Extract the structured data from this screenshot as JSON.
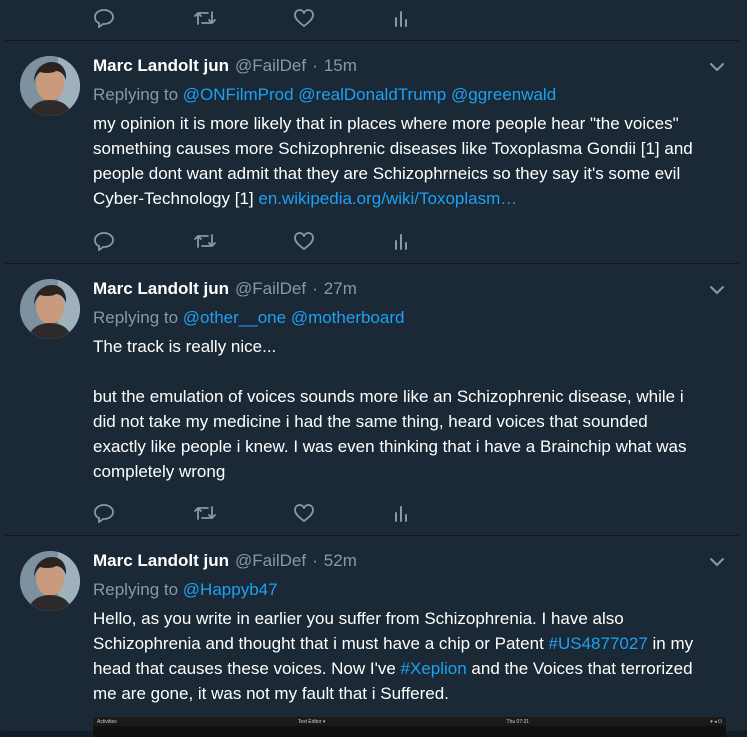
{
  "icons": {
    "reply": "reply-icon",
    "retweet": "retweet-icon",
    "like": "heart-icon",
    "analytics": "analytics-icon",
    "menu": "chevron-down-icon"
  },
  "colors": {
    "background": "#1b2836",
    "link": "#1da1f2",
    "muted": "#8899a6",
    "text": "#ffffff",
    "divider": "#10171e"
  },
  "tweets": [
    {
      "name": "Marc Landolt jun",
      "handle": "@FailDef",
      "separator": "·",
      "time": "15m",
      "replying_prefix": "Replying to",
      "replying_to": [
        "@ONFilmProd",
        "@realDonaldTrump",
        "@ggreenwald"
      ],
      "lines": [
        "my opinion it is more likely that in places where more people hear \"the voices\"",
        "something causes more Schizophrenic diseases like Toxoplasma Gondii [1] and",
        "people dont want admit that they are Schizophrneics so they say it's some evil",
        "Cyber-Technology [1] "
      ],
      "link": "en.wikipedia.org/wiki/Toxoplasm…"
    },
    {
      "name": "Marc Landolt jun",
      "handle": "@FailDef",
      "separator": "·",
      "time": "27m",
      "replying_prefix": "Replying to",
      "replying_to": [
        "@other__one",
        "@motherboard"
      ],
      "lines": [
        "The track is really nice...",
        "",
        "but the emulation of voices sounds  more like an Schizophrenic disease, while i",
        "did not take my medicine i had the same thing, heard voices that sounded",
        "exactly like people i knew. I was even thinking that i have a Brainchip what was",
        "completely wrong"
      ]
    },
    {
      "name": "Marc Landolt jun",
      "handle": "@FailDef",
      "separator": "·",
      "time": "52m",
      "replying_prefix": "Replying to",
      "replying_to": [
        "@Happyb47"
      ],
      "line1": "Hello, as you write in earlier you suffer from Schizophrenia. I have also",
      "line2_pre": "Schizophrenia and thought that i must have a chip or Patent ",
      "line2_tag": "#US4877027",
      "line2_post": " in my",
      "line3_pre": "head that causes these voices. Now I've ",
      "line3_tag": "#Xeplion",
      "line3_post": " and the Voices that terrorized",
      "line4": "me are gone, it was not my fault that i Suffered.",
      "screenshot_bar": {
        "left": "Activities",
        "app": "Text Editor ▾",
        "clock": "Thu 07:31"
      }
    }
  ]
}
